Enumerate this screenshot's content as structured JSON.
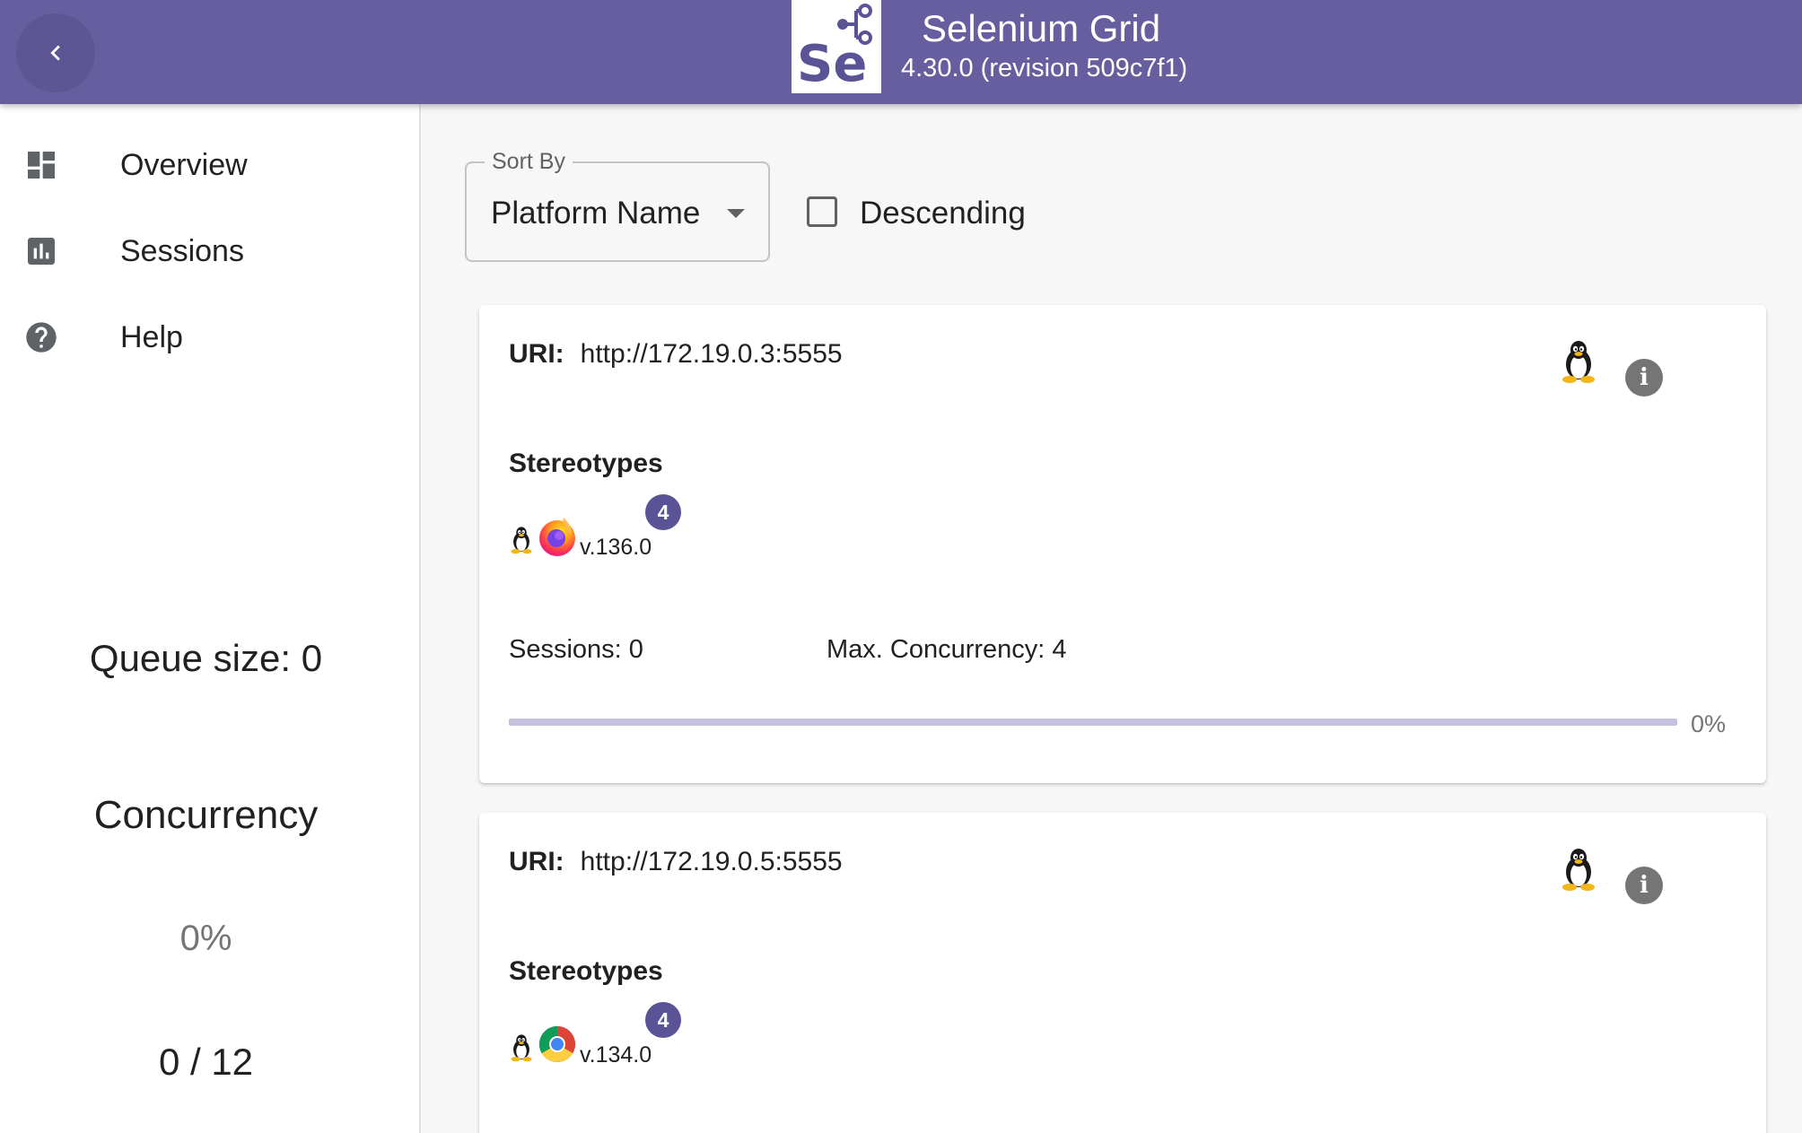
{
  "header": {
    "title": "Selenium Grid",
    "version": "4.30.0 (revision 509c7f1)",
    "logo_text": "Se",
    "back_icon": "chevron-left-icon"
  },
  "sidebar": {
    "items": [
      {
        "label": "Overview",
        "icon": "dashboard-icon"
      },
      {
        "label": "Sessions",
        "icon": "assessment-icon"
      },
      {
        "label": "Help",
        "icon": "help-icon"
      }
    ],
    "queue_size": "Queue size: 0",
    "concurrency_title": "Concurrency",
    "concurrency_percent": "0%",
    "concurrency_ratio": "0 / 12"
  },
  "sort": {
    "legend": "Sort By",
    "value": "Platform Name",
    "descending_label": "Descending",
    "descending_checked": false
  },
  "nodes": [
    {
      "uri_label": "URI:",
      "uri": "http://172.19.0.3:5555",
      "os_icon": "linux-icon",
      "stereotypes_title": "Stereotypes",
      "stereotype": {
        "os_icon": "linux-icon",
        "browser_icon": "firefox-icon",
        "version": "v.136.0",
        "slots": "4"
      },
      "sessions": "Sessions: 0",
      "max_concurrency": "Max. Concurrency: 4",
      "load_percent_label": "0%",
      "load_fraction": 0
    },
    {
      "uri_label": "URI:",
      "uri": "http://172.19.0.5:5555",
      "os_icon": "linux-icon",
      "stereotypes_title": "Stereotypes",
      "stereotype": {
        "os_icon": "linux-icon",
        "browser_icon": "chrome-icon",
        "version": "v.134.0",
        "slots": "4"
      }
    }
  ],
  "colors": {
    "primary": "#665e9e",
    "badge": "#5a5497",
    "progress_track": "#c4c0dd",
    "background": "#f6f7f6"
  }
}
